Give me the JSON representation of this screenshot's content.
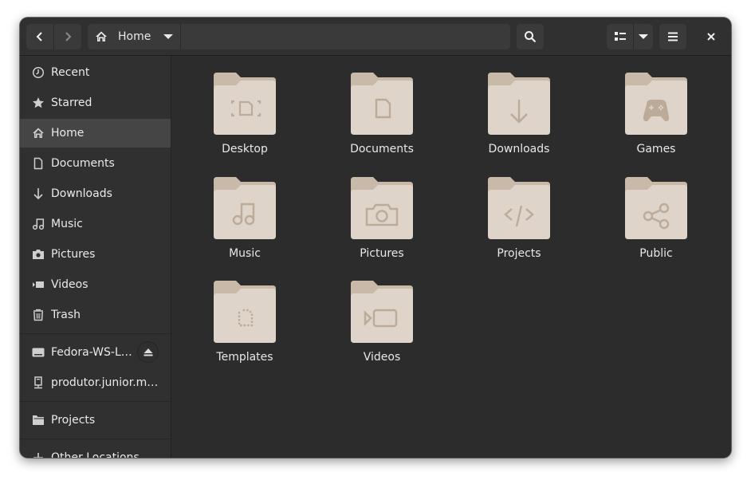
{
  "window": {
    "title": "Home"
  },
  "headerbar": {
    "back_icon": "chevron-left-icon",
    "forward_icon": "chevron-right-icon",
    "path": {
      "icon": "home-icon",
      "label": "Home",
      "dropdown_icon": "caret-down-icon"
    },
    "search_icon": "search-icon",
    "view_icon": "list-view-icon",
    "view_dropdown_icon": "caret-down-icon",
    "menu_icon": "hamburger-menu-icon",
    "close_icon": "close-icon"
  },
  "sidebar": {
    "items": [
      {
        "label": "Recent",
        "icon": "clock-icon",
        "active": false
      },
      {
        "label": "Starred",
        "icon": "star-icon",
        "active": false
      },
      {
        "label": "Home",
        "icon": "home-icon",
        "active": true
      },
      {
        "label": "Documents",
        "icon": "document-icon",
        "active": false
      },
      {
        "label": "Downloads",
        "icon": "arrow-down-icon",
        "active": false
      },
      {
        "label": "Music",
        "icon": "music-note-icon",
        "active": false
      },
      {
        "label": "Pictures",
        "icon": "camera-icon",
        "active": false
      },
      {
        "label": "Videos",
        "icon": "video-camera-icon",
        "active": false
      },
      {
        "label": "Trash",
        "icon": "trash-icon",
        "active": false
      }
    ],
    "devices": [
      {
        "label": "Fedora-WS-L…",
        "icon": "drive-icon",
        "eject_icon": "eject-icon"
      },
      {
        "label": "produtor.junior.m…",
        "icon": "computer-icon"
      }
    ],
    "bookmarks": [
      {
        "label": "Projects",
        "icon": "folder-icon"
      }
    ],
    "other": {
      "label": "Other Locations",
      "icon": "plus-icon"
    }
  },
  "content": {
    "folders": [
      {
        "name": "Desktop",
        "emblem": "desktop-icon"
      },
      {
        "name": "Documents",
        "emblem": "document-icon"
      },
      {
        "name": "Downloads",
        "emblem": "arrow-down-icon"
      },
      {
        "name": "Games",
        "emblem": "gamepad-icon"
      },
      {
        "name": "Music",
        "emblem": "music-note-icon"
      },
      {
        "name": "Pictures",
        "emblem": "camera-icon"
      },
      {
        "name": "Projects",
        "emblem": "code-icon"
      },
      {
        "name": "Public",
        "emblem": "share-icon"
      },
      {
        "name": "Templates",
        "emblem": "template-icon"
      },
      {
        "name": "Videos",
        "emblem": "video-camera-icon"
      }
    ]
  },
  "colors": {
    "folder_back": "#c9b9a9",
    "folder_front": "#ded4c9",
    "folder_emblem": "#bcab99",
    "sidebar_active": "#454545"
  }
}
